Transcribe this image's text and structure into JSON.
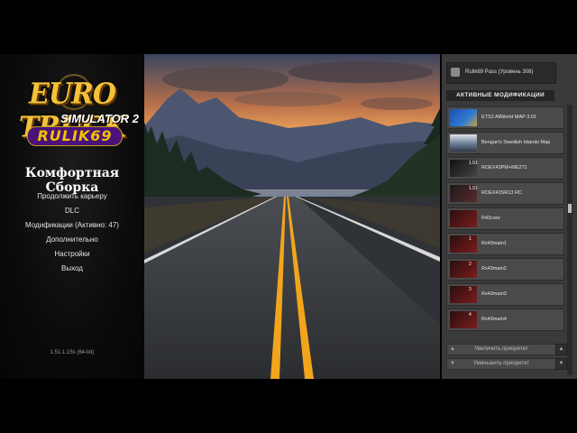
{
  "logo": {
    "line1": "EURO TRUCK",
    "line2": "SIMULATOR 2",
    "line3": "RULIK69"
  },
  "menu": {
    "subtitle": "Комфортная Сборка",
    "items": [
      {
        "label": "Продолжить карьеру"
      },
      {
        "label": "DLC"
      },
      {
        "label": "Модификации (Активно: 47)"
      },
      {
        "label": "Дополнительно"
      },
      {
        "label": "Настройки"
      },
      {
        "label": "Выход"
      }
    ],
    "version": "1.51.1.15s (64-bit)"
  },
  "panel": {
    "profile": "Rulik69 Pass (Уровень 308)",
    "header": "АКТИВНЫЕ МОДИФИКАЦИИ",
    "mods": [
      {
        "name": "ETS2 AllWorld MAP 3.01",
        "thumb_color": "#1f5fb8",
        "badge": ""
      },
      {
        "name": "Bengan's Swedish Islands Map",
        "thumb_color": "#7d8aa0",
        "badge": ""
      },
      {
        "name": "ROEX43PM+ME271",
        "thumb_color": "#1a1a1a",
        "badge": "1.51"
      },
      {
        "name": "ROEX43SR13 RC",
        "thumb_color": "#2b2b2b",
        "badge": "1.51"
      },
      {
        "name": "R43core",
        "thumb_color": "#3b1010",
        "badge": ""
      },
      {
        "name": "Rx43main1",
        "thumb_color": "#3b1010",
        "badge": "1"
      },
      {
        "name": "Rx43main2",
        "thumb_color": "#3b1010",
        "badge": "2"
      },
      {
        "name": "Rx43main3",
        "thumb_color": "#3b1010",
        "badge": "3"
      },
      {
        "name": "Rx43main4",
        "thumb_color": "#3b1010",
        "badge": "4"
      }
    ],
    "raise_priority": "Увеличить приоритет",
    "lower_priority": "Уменьшить приоритет"
  },
  "colors": {
    "accent_gold": "#f3c23a",
    "panel_bg": "#3a3a3a",
    "sky_top": "#3b4a66",
    "sky_glow": "#f39a4a",
    "road_line": "#f2a51c"
  }
}
